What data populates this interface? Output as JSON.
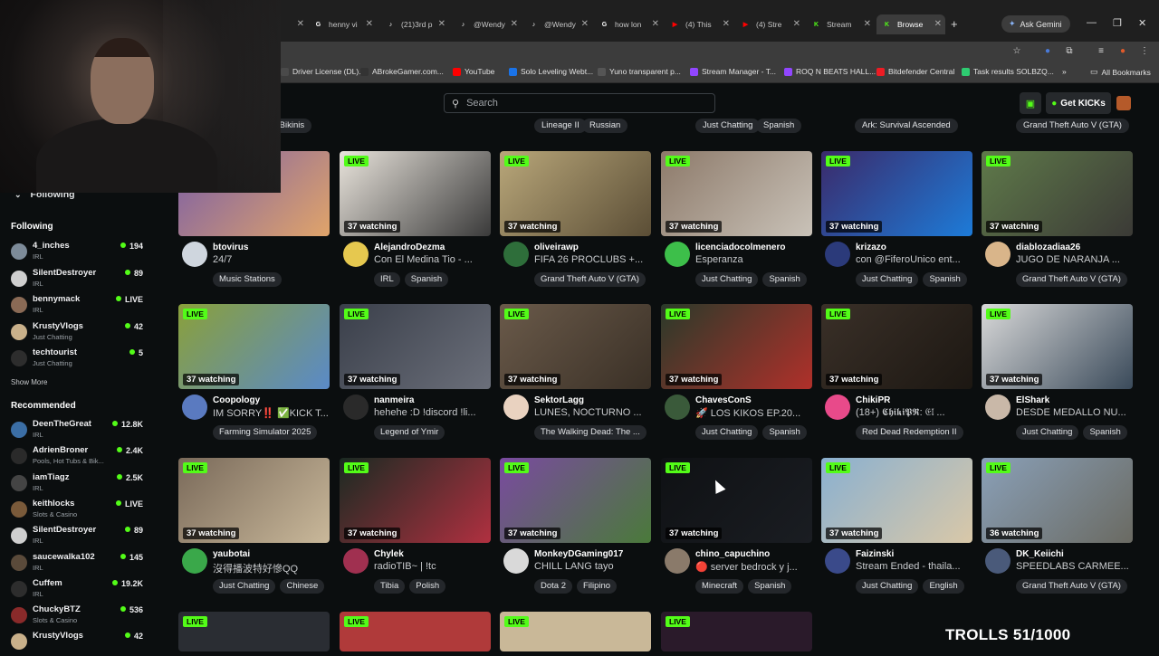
{
  "browser": {
    "tabs": [
      {
        "label": "henny vi",
        "icon": "google-icon",
        "color": "#ffffff"
      },
      {
        "label": "(21)3rd p",
        "icon": "tiktok-icon",
        "color": "#ffffff"
      },
      {
        "label": "@Wendy",
        "icon": "tiktok-icon",
        "color": "#ffffff"
      },
      {
        "label": "@Wendy",
        "icon": "tiktok-icon",
        "color": "#ffffff"
      },
      {
        "label": "how lon",
        "icon": "google-icon",
        "color": "#ffffff"
      },
      {
        "label": "(4) This",
        "icon": "youtube-icon",
        "color": "#ff0000"
      },
      {
        "label": "(4) Stre",
        "icon": "youtube-icon",
        "color": "#ff0000"
      },
      {
        "label": "Stream",
        "icon": "kick-icon",
        "color": "#53fc18"
      },
      {
        "label": "Browse",
        "icon": "kick-icon",
        "color": "#53fc18"
      }
    ],
    "gemini_label": "Ask Gemini",
    "bookmarks": [
      {
        "label": "Driver License (DL)...",
        "color": "#4a4a4a"
      },
      {
        "label": "ABrokeGamer.com...",
        "color": "#333333"
      },
      {
        "label": "YouTube",
        "color": "#ff0000"
      },
      {
        "label": "Solo Leveling Webt...",
        "color": "#1a73e8"
      },
      {
        "label": "Yuno transparent p...",
        "color": "#555555"
      },
      {
        "label": "Stream Manager - T...",
        "color": "#9146ff"
      },
      {
        "label": "ROQ N BEATS HALL...",
        "color": "#9146ff"
      },
      {
        "label": "Bitdefender Central",
        "color": "#ed1c24"
      },
      {
        "label": "Task results SOLBZQ...",
        "color": "#2ecc71"
      }
    ],
    "all_bookmarks": "All Bookmarks"
  },
  "header": {
    "search_placeholder": "Search",
    "get_kicks": "Get KICKs"
  },
  "sidebar": {
    "toggle_label": "Following",
    "following_heading": "Following",
    "following": [
      {
        "name": "4_inches",
        "sub": "IRL",
        "count": "194",
        "color": "#7d8b99"
      },
      {
        "name": "SilentDestroyer",
        "sub": "IRL",
        "count": "89",
        "color": "#cfcfcf"
      },
      {
        "name": "bennymack",
        "sub": "IRL",
        "count": "LIVE",
        "color": "#8a6a55"
      },
      {
        "name": "KrustyVlogs",
        "sub": "Just Chatting",
        "count": "42",
        "color": "#c9b08a"
      },
      {
        "name": "techtourist",
        "sub": "Just Chatting",
        "count": "5",
        "color": "#2d2d2d"
      }
    ],
    "show_more": "Show More",
    "recommended_heading": "Recommended",
    "recommended": [
      {
        "name": "DeenTheGreat",
        "sub": "IRL",
        "count": "12.8K",
        "color": "#3b6ea5"
      },
      {
        "name": "AdrienBroner",
        "sub": "Pools, Hot Tubs & Bik...",
        "count": "2.4K",
        "color": "#2a2a2a"
      },
      {
        "name": "iamTiagz",
        "sub": "IRL",
        "count": "2.5K",
        "color": "#444444"
      },
      {
        "name": "keithlocks",
        "sub": "Slots & Casino",
        "count": "LIVE",
        "color": "#7a5a3a"
      },
      {
        "name": "SilentDestroyer",
        "sub": "IRL",
        "count": "89",
        "color": "#cfcfcf"
      },
      {
        "name": "saucewalka102",
        "sub": "IRL",
        "count": "145",
        "color": "#5a4a3a"
      },
      {
        "name": "Cuffem",
        "sub": "IRL",
        "count": "19.2K",
        "color": "#2d2d2d"
      },
      {
        "name": "ChuckyBTZ",
        "sub": "Slots & Casino",
        "count": "536",
        "color": "#8a2a2a"
      },
      {
        "name": "KrustyVlogs",
        "sub": "",
        "count": "42",
        "color": "#c9b08a"
      }
    ]
  },
  "top_tags": [
    "Pools, Hot Tubs & Bikinis",
    "Lineage II",
    "Russian",
    "Just Chatting",
    "Spanish",
    "Ark: Survival Ascended",
    "Grand Theft Auto V (GTA)"
  ],
  "live_label": "LIVE",
  "cards": [
    {
      "name": "btovirus",
      "title": "24/7",
      "watching": "",
      "tags": [
        "Music Stations"
      ],
      "thumb": "#7b5ea6",
      "thumb2": "#e0a46a",
      "avatar": "#cfd6de"
    },
    {
      "name": "AlejandroDezma",
      "title": "Con El Medina Tio - ...",
      "watching": "37 watching",
      "tags": [
        "IRL",
        "Spanish"
      ],
      "thumb": "#e9e4dc",
      "thumb2": "#3a3a3a",
      "avatar": "#e6c84f"
    },
    {
      "name": "oliveirawp",
      "title": "FIFA 26 PROCLUBS +...",
      "watching": "37 watching",
      "tags": [
        "Grand Theft Auto V (GTA)"
      ],
      "thumb": "#b9a77a",
      "thumb2": "#5b4e36",
      "avatar": "#2e6e3a"
    },
    {
      "name": "licenciadocolmenero",
      "title": "Esperanza",
      "watching": "37 watching",
      "tags": [
        "Just Chatting",
        "Spanish"
      ],
      "thumb": "#8d7a6a",
      "thumb2": "#c9c2b8",
      "avatar": "#3dbf4a"
    },
    {
      "name": "krizazo",
      "title": "con @FiferoUnico ent...",
      "watching": "37 watching",
      "tags": [
        "Just Chatting",
        "Spanish"
      ],
      "thumb": "#3b2a6a",
      "thumb2": "#1d7bd8",
      "avatar": "#2b3a7a"
    },
    {
      "name": "diablozadiaa26",
      "title": "JUGO DE NARANJA ...",
      "watching": "37 watching",
      "tags": [
        "Grand Theft Auto V (GTA)"
      ],
      "thumb": "#5f7a4a",
      "thumb2": "#3b3a36",
      "avatar": "#d9b58a"
    },
    {
      "name": "Coopology",
      "title": "IM SORRY‼️ ✅KICK T...",
      "watching": "37 watching",
      "tags": [
        "Farming Simulator 2025"
      ],
      "thumb": "#8aa03a",
      "thumb2": "#5a8ac8",
      "avatar": "#5a7ac0"
    },
    {
      "name": "nanmeira",
      "title": "hehehe :D !discord !li...",
      "watching": "37 watching",
      "tags": [
        "Legend of Ymir"
      ],
      "thumb": "#3a3f4a",
      "thumb2": "#6b6f7a",
      "avatar": "#2a2a2a"
    },
    {
      "name": "SektorLagg",
      "title": "LUNES, NOCTURNO ...",
      "watching": "37 watching",
      "tags": [
        "The Walking Dead: The ..."
      ],
      "thumb": "#6a5a4a",
      "thumb2": "#3a3026",
      "avatar": "#e9d2c0"
    },
    {
      "name": "ChavesConS",
      "title": "🚀 LOS KIKOS EP.20...",
      "watching": "37 watching",
      "tags": [
        "Just Chatting",
        "Spanish"
      ],
      "thumb": "#2a3a2a",
      "thumb2": "#b0302a",
      "avatar": "#3a5a3a"
    },
    {
      "name": "ChikiPR",
      "title": "(18+) 𝕮𝖍𝖎𝖐𝖎𝕻𝕽: 𝔈𝔩 ...",
      "watching": "37 watching",
      "tags": [
        "Red Dead Redemption II"
      ],
      "thumb": "#3a3028",
      "thumb2": "#1c1712",
      "avatar": "#e84a8a"
    },
    {
      "name": "ElShark",
      "title": "DESDE MEDALLO NU...",
      "watching": "37 watching",
      "tags": [
        "Just Chatting",
        "Spanish"
      ],
      "thumb": "#d9d9d9",
      "thumb2": "#3a4a5a",
      "avatar": "#c9b8a8"
    },
    {
      "name": "yaubotai",
      "title": "沒得播波特好慘QQ",
      "watching": "37 watching",
      "tags": [
        "Just Chatting",
        "Chinese"
      ],
      "thumb": "#7a6a5a",
      "thumb2": "#c9b89a",
      "avatar": "#3aa84a"
    },
    {
      "name": "Chylek",
      "title": "radioTIB~ | !tc",
      "watching": "37 watching",
      "tags": [
        "Tibia",
        "Polish"
      ],
      "thumb": "#1a2a22",
      "thumb2": "#b03040",
      "avatar": "#a03050"
    },
    {
      "name": "MonkeyDGaming017",
      "title": "CHILL LANG tayo",
      "watching": "37 watching",
      "tags": [
        "Dota 2",
        "Filipino"
      ],
      "thumb": "#7a4aa0",
      "thumb2": "#4a7a3a",
      "avatar": "#d9d9d9"
    },
    {
      "name": "chino_capuchino",
      "title": "🔴 server bedrock y j...",
      "watching": "37 watching",
      "tags": [
        "Minecraft",
        "Spanish"
      ],
      "thumb": "#0f1114",
      "thumb2": "#1a1d22",
      "avatar": "#8a7a6a"
    },
    {
      "name": "Faizinski",
      "title": "Stream Ended - thaila...",
      "watching": "37 watching",
      "tags": [
        "Just Chatting",
        "English"
      ],
      "thumb": "#8ab0d0",
      "thumb2": "#d9c8a8",
      "avatar": "#3a4a8a"
    },
    {
      "name": "DK_Keiichi",
      "title": "SPEEDLABS CARMEE...",
      "watching": "36 watching",
      "tags": [
        "Grand Theft Auto V (GTA)"
      ],
      "thumb": "#8aa0b8",
      "thumb2": "#6a6a62",
      "avatar": "#4a5a7a"
    }
  ],
  "bottom_row_thumbs": [
    "#2a2d33",
    "#b03a3a",
    "#c9b898",
    "#2a1a2a"
  ],
  "overlay_text": "TROLLS 51/1000"
}
